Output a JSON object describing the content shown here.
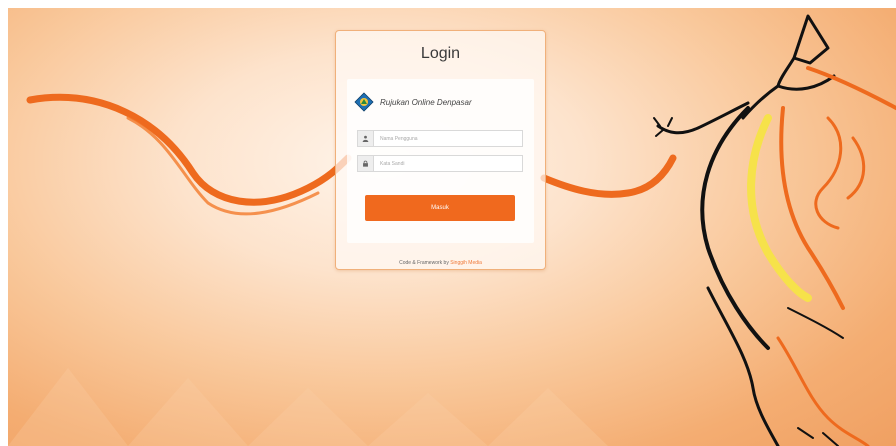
{
  "card": {
    "title": "Login",
    "brand_name": "Rujukan Online Denpasar",
    "username_placeholder": "Nama Pengguna",
    "password_placeholder": "Kata Sandi",
    "submit_label": "Masuk",
    "footer_prefix": "Code & Framework by",
    "footer_link": "Singgih Media"
  },
  "icons": {
    "username": "user-icon",
    "password": "lock-icon",
    "logo": "city-emblem"
  },
  "colors": {
    "accent": "#f0691e",
    "background": "#f9c89b",
    "figure_stroke": "#111111",
    "figure_yellow": "#f6e24a"
  }
}
